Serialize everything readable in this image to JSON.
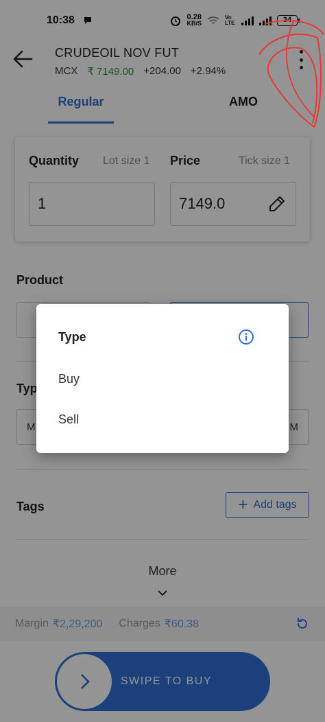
{
  "status": {
    "time": "10:38",
    "net_speed_value": "0.28",
    "net_speed_unit": "KB/S",
    "volte_label": "Vo LTE",
    "battery": "34"
  },
  "header": {
    "title": "CRUDEOIL NOV FUT",
    "exchange": "MCX",
    "ltp": "₹ 7149.00",
    "change": "+204.00",
    "change_pct": "+2.94%"
  },
  "tabs": [
    {
      "label": "Regular",
      "active": true
    },
    {
      "label": "AMO",
      "active": false
    }
  ],
  "order": {
    "quantity_label": "Quantity",
    "lot_size": "Lot size  1",
    "price_label": "Price",
    "tick_size": "Tick size  1",
    "quantity_value": "1",
    "price_value": "7149.0"
  },
  "sections": {
    "product_label": "Product",
    "type_label_partial": "Typ",
    "type_left_partial": "M",
    "type_right_partial": "M",
    "tags_label": "Tags",
    "add_tags": "Add tags",
    "more": "More"
  },
  "footer": {
    "margin_label": "Margin",
    "margin_value": "₹2,29,200",
    "charges_label": "Charges",
    "charges_value": "₹60.38"
  },
  "swipe": {
    "label": "SWIPE TO BUY"
  },
  "dialog": {
    "title": "Type",
    "options": [
      "Buy",
      "Sell"
    ]
  },
  "colors": {
    "accent": "#2f6fd6",
    "positive": "#2e8b3a",
    "annotation": "#e53935"
  }
}
